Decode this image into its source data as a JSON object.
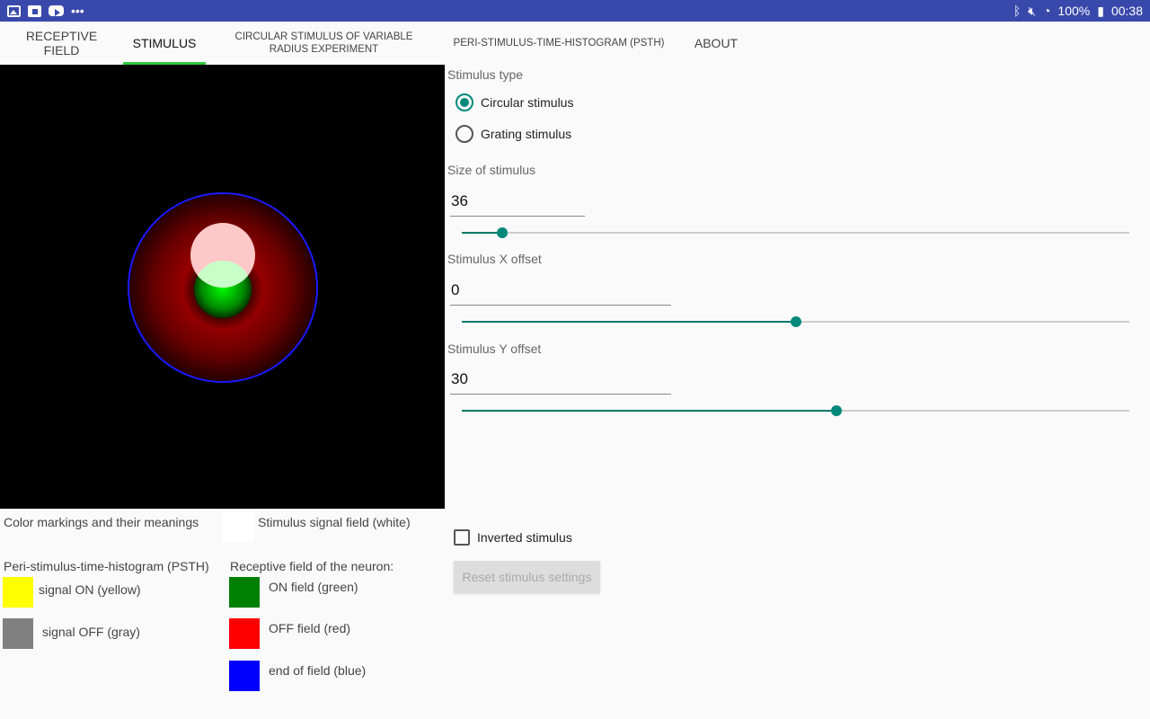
{
  "status_bar": {
    "left_icons": [
      "gallery-icon",
      "flipboard-icon",
      "youtube-icon",
      "more-icon"
    ],
    "more_glyph": "•••",
    "right_icons": [
      "bluetooth-icon",
      "mute-icon",
      "wifi-icon"
    ],
    "battery": "100%",
    "time": "00:38"
  },
  "tabs": [
    {
      "label": "RECEPTIVE FIELD",
      "active": false
    },
    {
      "label": "STIMULUS",
      "active": true
    },
    {
      "label": "CIRCULAR STIMULUS OF VARIABLE RADIUS EXPERIMENT",
      "active": false
    },
    {
      "label": "PERI-STIMULUS-TIME-HISTOGRAM (PSTH)",
      "active": false
    },
    {
      "label": "ABOUT",
      "active": false
    }
  ],
  "controls": {
    "stimulus_type_label": "Stimulus type",
    "radio_circular": "Circular stimulus",
    "radio_grating": "Grating stimulus",
    "selected_type": "circular",
    "size_label": "Size of stimulus",
    "size_value": "36",
    "size_slider_fraction": 0.06,
    "x_label": "Stimulus X offset",
    "x_value": "0",
    "x_slider_fraction": 0.5,
    "y_label": "Stimulus Y offset",
    "y_value": "30",
    "y_slider_fraction": 0.561,
    "inverted_label": "Inverted stimulus",
    "inverted_checked": false,
    "reset_label": "Reset stimulus settings"
  },
  "legend": {
    "title": "Color markings and their meanings",
    "stimulus_field": "Stimulus signal field (white)",
    "psth_title": "Peri-stimulus-time-histogram (PSTH)",
    "signal_on": "signal ON (yellow)",
    "signal_off": "signal OFF (gray)",
    "rf_title": "Receptive field of the neuron:",
    "on_field": "ON field (green)",
    "off_field": "OFF field (red)",
    "end_field": "end of field (blue)"
  },
  "colors": {
    "accent": "#00897b",
    "tab_indicator": "#2ecc40",
    "status_bar": "#3949ab",
    "stimulus_white": "#ffffff",
    "signal_on_yellow": "#ffff00",
    "signal_off_gray": "#808080",
    "on_field_green": "#008000",
    "off_field_red": "#ff0000",
    "end_field_blue": "#0000ff"
  }
}
